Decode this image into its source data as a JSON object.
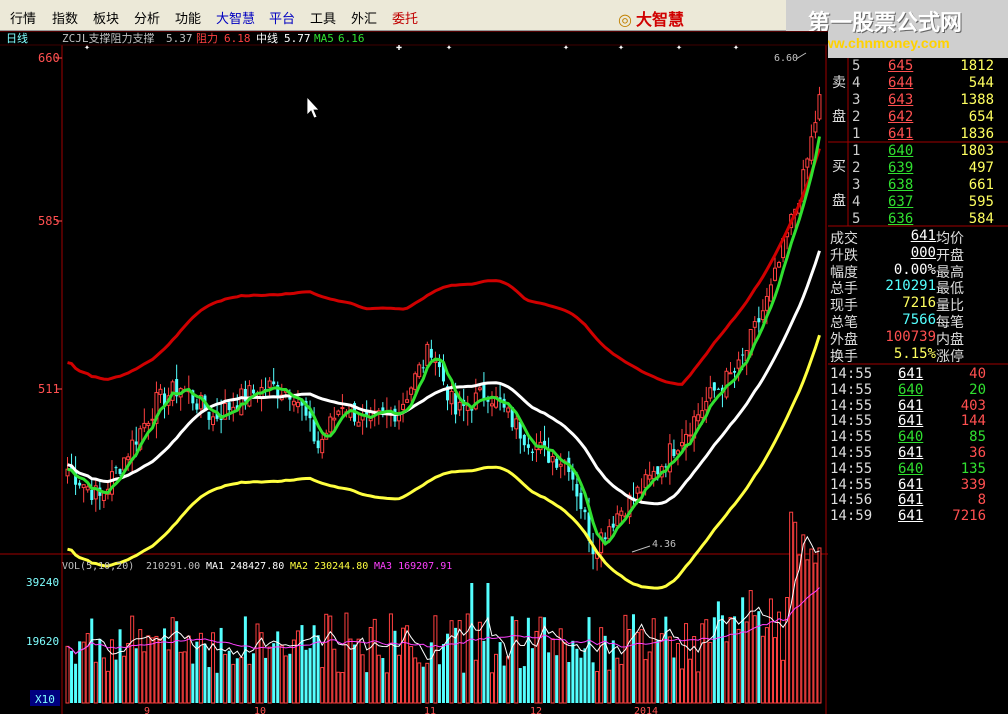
{
  "menu": {
    "items": [
      "行情",
      "指数",
      "板块",
      "分析",
      "功能",
      "大智慧",
      "平台",
      "工具",
      "外汇",
      "委托"
    ]
  },
  "brand": {
    "logo": "大智慧"
  },
  "watermark": {
    "line1": "第一股票公式网",
    "line2": "www.chnmoney.com"
  },
  "chart_header": {
    "period": "日线",
    "title": "ZCJL支撑阻力支撑",
    "support_value": "5.37",
    "resistance_label": "阻力",
    "resistance_value": "6.18",
    "mid_label": "中线",
    "mid_value": "5.77",
    "ma5_label": "MA5",
    "ma5_value": "6.16"
  },
  "price_axis": {
    "labels": [
      "660",
      "585",
      "511"
    ]
  },
  "annotations": {
    "high_label": "6.60",
    "low_label": "4.36"
  },
  "volume_header": {
    "name": "VOL(5,10,20)",
    "value": "210291.00",
    "ma1": "MA1 248427.80",
    "ma2": "MA2 230244.80",
    "ma3": "MA3 169207.91"
  },
  "volume_axis": {
    "labels": [
      "39240",
      "19620",
      "X10"
    ]
  },
  "date_axis": {
    "labels": [
      "9",
      "10",
      "11",
      "12",
      "2014"
    ]
  },
  "colors": {
    "up": "#ff4040",
    "down": "#54ffff",
    "resistance": "#d00000",
    "mid": "#ffffff",
    "support": "#ffff40",
    "ma": "#30e030",
    "volma1": "#ffffff",
    "volma3": "#ff40ff"
  },
  "order_book": {
    "sell_label": [
      "卖",
      "盘"
    ],
    "buy_label": [
      "买",
      "盘"
    ],
    "sell": [
      {
        "level": "5",
        "price": "645",
        "vol": "1812"
      },
      {
        "level": "4",
        "price": "644",
        "vol": "544"
      },
      {
        "level": "3",
        "price": "643",
        "vol": "1388"
      },
      {
        "level": "2",
        "price": "642",
        "vol": "654"
      },
      {
        "level": "1",
        "price": "641",
        "vol": "1836"
      }
    ],
    "buy": [
      {
        "level": "1",
        "price": "640",
        "vol": "1803"
      },
      {
        "level": "2",
        "price": "639",
        "vol": "497"
      },
      {
        "level": "3",
        "price": "638",
        "vol": "661"
      },
      {
        "level": "4",
        "price": "637",
        "vol": "595"
      },
      {
        "level": "5",
        "price": "636",
        "vol": "584"
      }
    ]
  },
  "stats": [
    {
      "label": "成交",
      "value": "641",
      "label2": "均价"
    },
    {
      "label": "升跌",
      "value": "000",
      "label2": "开盘"
    },
    {
      "label": "幅度",
      "value": "0.00%",
      "label2": "最高"
    },
    {
      "label": "总手",
      "value": "210291",
      "label2": "最低"
    },
    {
      "label": "现手",
      "value": "7216",
      "label2": "量比"
    },
    {
      "label": "总笔",
      "value": "7566",
      "label2": "每笔"
    },
    {
      "label": "外盘",
      "value": "100739",
      "label2": "内盘"
    },
    {
      "label": "换手",
      "value": "5.15%",
      "label2": "涨停"
    }
  ],
  "ticks": [
    {
      "time": "14:55",
      "price": "641",
      "vol": "40"
    },
    {
      "time": "14:55",
      "price": "640",
      "vol": "20"
    },
    {
      "time": "14:55",
      "price": "641",
      "vol": "403"
    },
    {
      "time": "14:55",
      "price": "641",
      "vol": "144"
    },
    {
      "time": "14:55",
      "price": "640",
      "vol": "85"
    },
    {
      "time": "14:55",
      "price": "641",
      "vol": "36"
    },
    {
      "time": "14:55",
      "price": "640",
      "vol": "135"
    },
    {
      "time": "14:55",
      "price": "641",
      "vol": "339"
    },
    {
      "time": "14:56",
      "price": "641",
      "vol": "8"
    },
    {
      "time": "14:59",
      "price": "641",
      "vol": "7216"
    }
  ]
}
